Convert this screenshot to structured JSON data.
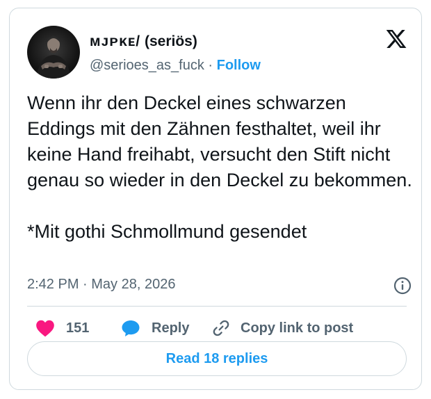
{
  "author": {
    "display_name_glyphs": "ᴍᴊᴘᴋᴇ/",
    "display_name_suffix": "(seriös)",
    "handle": "@serioes_as_fuck",
    "separator": "·",
    "follow_label": "Follow",
    "avatar_icon": "person-portrait-dark"
  },
  "brand": {
    "logo_icon": "x-logo"
  },
  "tweet": {
    "text": "Wenn ihr den Deckel eines schwarzen Eddings mit den Zähnen festhaltet, weil ihr keine Hand freihabt, versucht den Stift nicht genau so wieder in den Deckel zu bekommen.\n\n*Mit gothi Schmollmund gesendet",
    "timestamp": "2:42 PM · May 28, 2026"
  },
  "actions": {
    "like_count": "151",
    "reply_label": "Reply",
    "copy_link_label": "Copy link to post",
    "read_replies_label": "Read 18 replies"
  },
  "colors": {
    "accent": "#1d9bf0",
    "like": "#f91880",
    "muted": "#536471",
    "border": "#cfd9de",
    "text": "#0f1419"
  }
}
